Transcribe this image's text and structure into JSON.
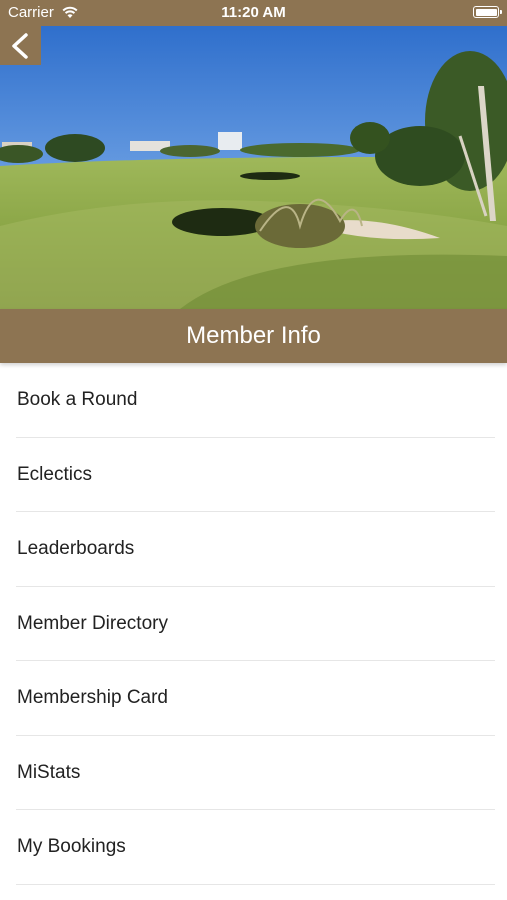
{
  "status_bar": {
    "carrier": "Carrier",
    "time": "11:20 AM",
    "battery_level": 1.0
  },
  "header": {
    "back_icon": "chevron-left-icon",
    "title": "Member Info"
  },
  "hero": {
    "image_description_icon": "golf-course-photo"
  },
  "colors": {
    "brand": "#8d7452",
    "text": "#222222",
    "separator": "#e6e6e6"
  },
  "menu": {
    "items": [
      {
        "label": "Book a Round"
      },
      {
        "label": "Eclectics"
      },
      {
        "label": "Leaderboards"
      },
      {
        "label": "Member Directory"
      },
      {
        "label": "Membership Card"
      },
      {
        "label": "MiStats"
      },
      {
        "label": "My Bookings"
      }
    ]
  }
}
